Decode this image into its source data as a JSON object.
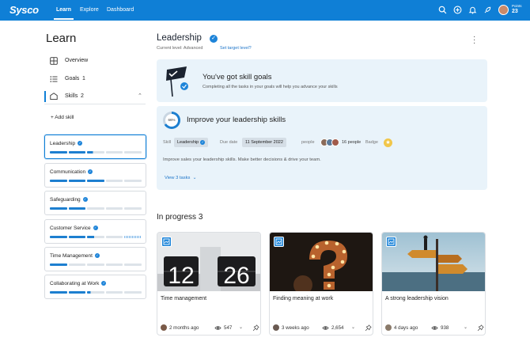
{
  "topbar": {
    "logo": "Sysco",
    "nav": [
      "Learn",
      "Explore",
      "Dashboard"
    ],
    "active_nav": "Learn",
    "icons": [
      "search-icon",
      "add-circle-icon",
      "bell-icon",
      "rocket-icon"
    ],
    "points_label": "Points",
    "points_value": "23",
    "brand_color": "#0f7fd6"
  },
  "sidebar": {
    "title": "Learn",
    "links": [
      {
        "label": "Overview",
        "count": "",
        "icon": "overview-icon"
      },
      {
        "label": "Goals",
        "count": "1",
        "icon": "list-icon"
      },
      {
        "label": "Skills",
        "count": "2",
        "icon": "skills-icon"
      }
    ],
    "add_skill": "+ Add skill",
    "skills": [
      {
        "name": "Leadership",
        "selected": true,
        "progress": [
          1,
          1,
          0.35,
          0,
          0
        ]
      },
      {
        "name": "Communication",
        "selected": false,
        "progress": [
          1,
          1,
          1,
          0,
          0
        ]
      },
      {
        "name": "Safeguarding",
        "selected": false,
        "progress": [
          1,
          1,
          0,
          0,
          0
        ]
      },
      {
        "name": "Customer Service",
        "selected": false,
        "progress": [
          1,
          1,
          0.4,
          0,
          -1
        ]
      },
      {
        "name": "Time Management",
        "selected": false,
        "progress": [
          1,
          0,
          0,
          0,
          0
        ]
      },
      {
        "name": "Collaborating at Work",
        "selected": false,
        "progress": [
          1,
          1,
          0.2,
          0,
          0
        ]
      }
    ]
  },
  "main": {
    "title": "Leadership",
    "current_level": "Current level: Advanced",
    "target_link": "Set target level?",
    "goals_banner": {
      "title": "You've got skill goals",
      "desc": "Completing all the tasks in your goals will help you advance your skills"
    },
    "improve": {
      "percent_label": "66%",
      "percent": 66,
      "title": "Improve your leadership skills",
      "skill_label": "Skill",
      "skill_value": "Leadership",
      "due_label": "Due date",
      "due_value": "11 September 2022",
      "people_label": "people",
      "people_count": "16 people",
      "badge_label": "Badge",
      "desc": "Improve sales your leadership skills. Make better decisions & drive your team.",
      "view_tasks": "View 3 tasks"
    },
    "in_progress": {
      "title": "In progress",
      "count": "3",
      "cards": [
        {
          "title": "Time management",
          "time": "2 months ago",
          "views": "547"
        },
        {
          "title": "Finding meaning at work",
          "time": "3 weeks ago",
          "views": "2,654"
        },
        {
          "title": "A strong leadership vision",
          "time": "4 days ago",
          "views": "938"
        }
      ]
    }
  }
}
